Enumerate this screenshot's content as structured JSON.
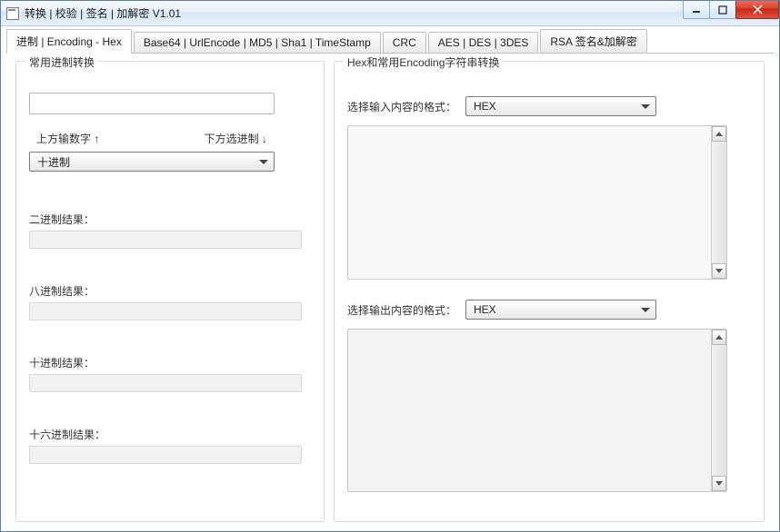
{
  "window": {
    "title": "转换 | 校验 | 签名 | 加解密 V1.01"
  },
  "tabs": [
    "进制  |  Encoding - Hex",
    "Base64  |  UrlEncode  |  MD5  |  Sha1  |  TimeStamp",
    "CRC",
    "AES  |  DES  |  3DES",
    "RSA 签名&加解密"
  ],
  "left": {
    "legend": "常用进制转换",
    "hint_up": "上方输数字 ↑",
    "hint_down": "下方选进制 ↓",
    "radix_selected": "十进制",
    "res_bin": "二进制结果：",
    "res_oct": "八进制结果：",
    "res_dec": "十进制结果：",
    "res_hex": "十六进制结果："
  },
  "right": {
    "legend": "Hex和常用Encoding字符串转换",
    "in_label": "选择输入内容的格式：",
    "in_selected": "HEX",
    "out_label": "选择输出内容的格式：",
    "out_selected": "HEX"
  }
}
